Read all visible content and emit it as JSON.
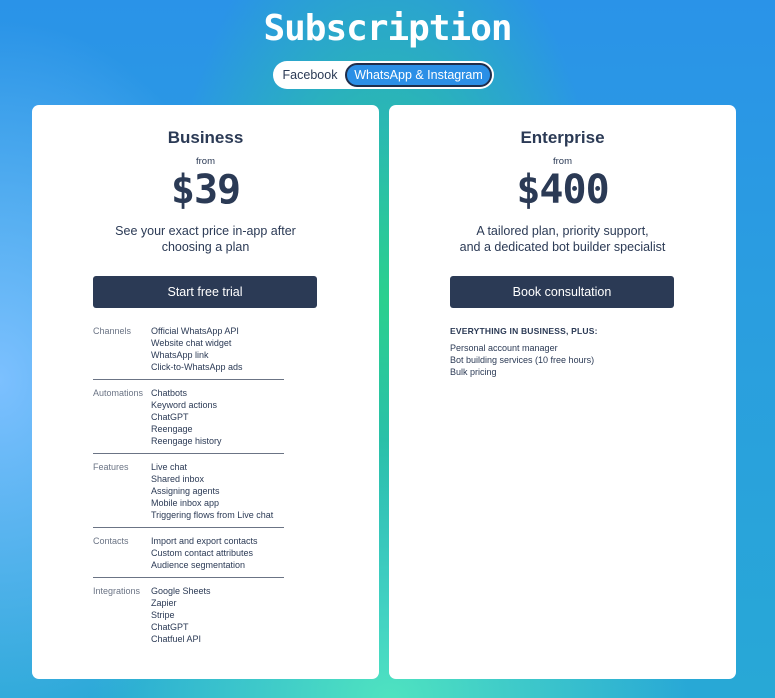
{
  "page": {
    "title": "Subscription"
  },
  "toggle": {
    "options": [
      "Facebook",
      "WhatsApp & Instagram"
    ],
    "selected": "WhatsApp & Instagram"
  },
  "plans": [
    {
      "name": "Business",
      "from": "from",
      "price": "$39",
      "description": [
        "See your exact price in-app after",
        "choosing a plan"
      ],
      "cta": "Start free trial",
      "feature_groups": [
        {
          "label": "Channels",
          "items": [
            "Official WhatsApp API",
            "Website chat widget",
            "WhatsApp link",
            "Click-to-WhatsApp ads"
          ]
        },
        {
          "label": "Automations",
          "items": [
            "Chatbots",
            "Keyword actions",
            "ChatGPT",
            "Reengage",
            "Reengage history"
          ]
        },
        {
          "label": "Features",
          "items": [
            "Live chat",
            "Shared inbox",
            "Assigning agents",
            "Mobile inbox app",
            "Triggering flows from Live chat"
          ]
        },
        {
          "label": "Contacts",
          "items": [
            "Import and export contacts",
            "Custom contact attributes",
            "Audience segmentation"
          ]
        },
        {
          "label": "Integrations",
          "items": [
            "Google Sheets",
            "Zapier",
            "Stripe",
            "ChatGPT",
            "Chatfuel API"
          ]
        }
      ]
    },
    {
      "name": "Enterprise",
      "from": "from",
      "price": "$400",
      "description": [
        "A tailored plan, priority support,",
        "and a dedicated bot builder specialist"
      ],
      "cta": "Book consultation",
      "plus_title": "EVERYTHING IN BUSINESS, PLUS:",
      "plus_items": [
        "Personal account manager",
        "Bot building services (10 free hours)",
        "Bulk pricing"
      ]
    }
  ],
  "colors": {
    "accent": "#2b8fe6",
    "button": "#2b3a55",
    "text": "#2b3a55"
  }
}
